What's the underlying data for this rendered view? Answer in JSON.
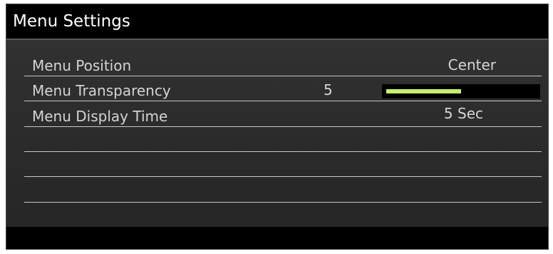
{
  "window": {
    "title": "Menu Settings"
  },
  "menu_position": {
    "label": "Menu Position",
    "value": "Center"
  },
  "menu_transparency": {
    "label": "Menu Transparency",
    "value": "5",
    "level_fraction": 0.5
  },
  "menu_display_time": {
    "label": "Menu Display Time",
    "value": "5 Sec"
  },
  "colors": {
    "accent": "#c3f06f",
    "background": "#121212",
    "text": "#d4d4d4"
  }
}
